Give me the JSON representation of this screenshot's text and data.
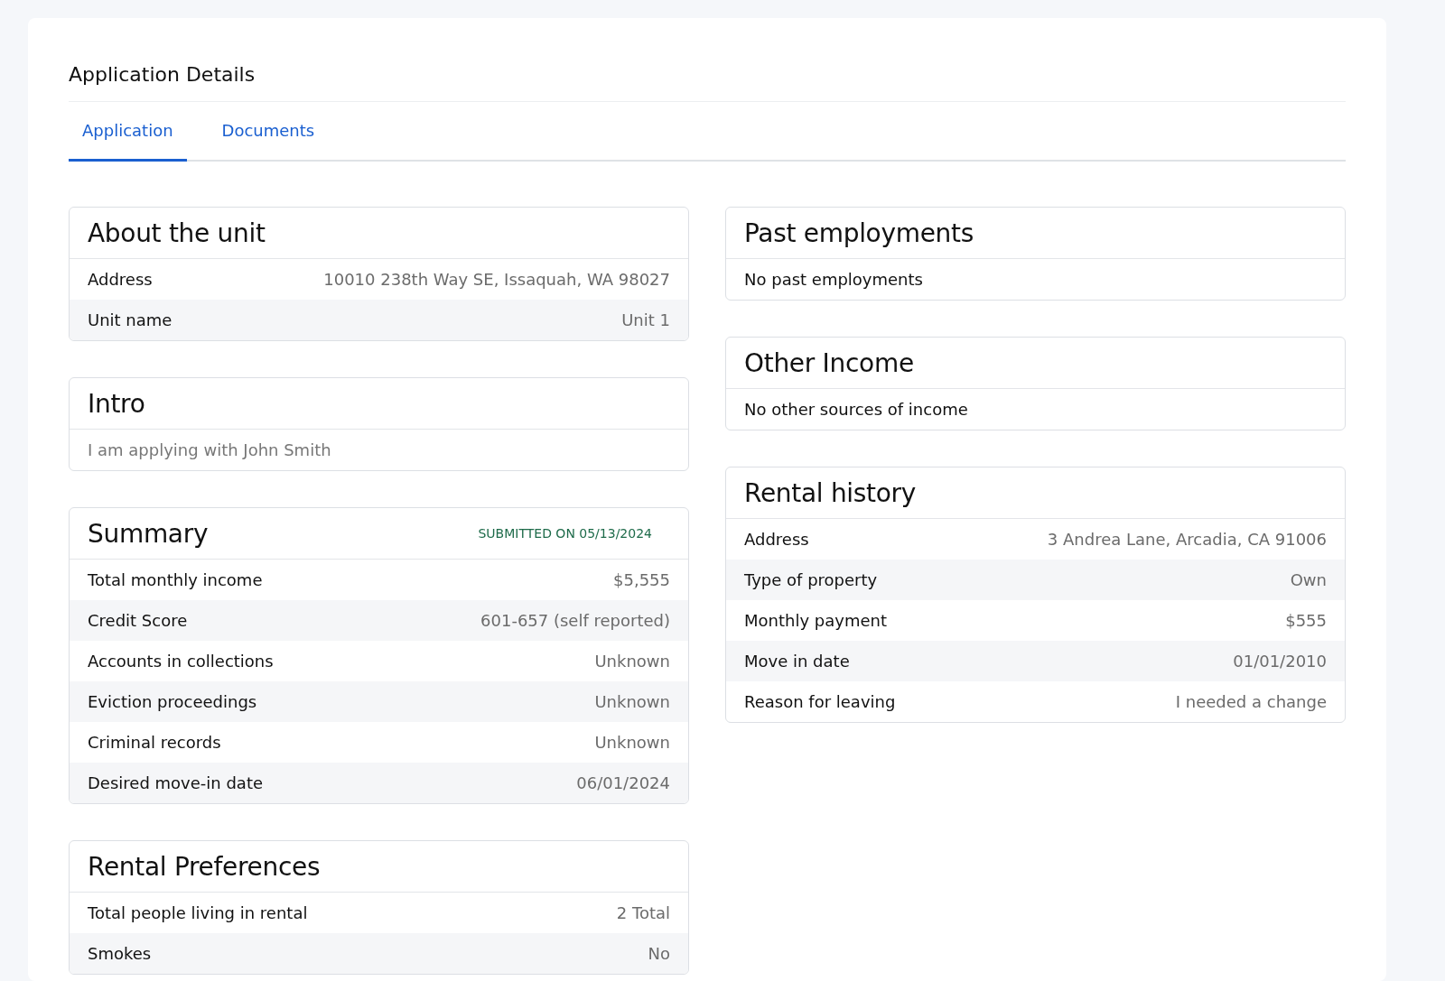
{
  "page": {
    "title": "Application Details"
  },
  "tabs": [
    {
      "label": "Application",
      "selected": true
    },
    {
      "label": "Documents",
      "selected": false
    }
  ],
  "left_column": [
    {
      "kind": "table",
      "title": "About the unit",
      "rows": [
        {
          "label": "Address",
          "value": "10010 238th Way SE, Issaquah, WA 98027"
        },
        {
          "label": "Unit name",
          "value": "Unit 1"
        }
      ]
    },
    {
      "kind": "text",
      "title": "Intro",
      "text": "I am applying with John Smith",
      "muted": true
    },
    {
      "kind": "table",
      "title": "Summary",
      "badge": "SUBMITTED ON 05/13/2024",
      "rows": [
        {
          "label": "Total monthly income",
          "value": "$5,555"
        },
        {
          "label": "Credit Score",
          "value": "601-657 (self reported)"
        },
        {
          "label": "Accounts in collections",
          "value": "Unknown"
        },
        {
          "label": "Eviction proceedings",
          "value": "Unknown"
        },
        {
          "label": "Criminal records",
          "value": "Unknown"
        },
        {
          "label": "Desired move-in date",
          "value": "06/01/2024"
        }
      ]
    },
    {
      "kind": "table",
      "title": "Rental Preferences",
      "rows": [
        {
          "label": "Total people living in rental",
          "value": "2 Total"
        },
        {
          "label": "Smokes",
          "value": "No"
        }
      ]
    }
  ],
  "right_column": [
    {
      "kind": "text",
      "title": "Past employments",
      "text": "No past employments",
      "muted": false
    },
    {
      "kind": "text",
      "title": "Other Income",
      "text": "No other sources of income",
      "muted": false
    },
    {
      "kind": "table",
      "title": "Rental history",
      "rows": [
        {
          "label": "Address",
          "value": "3 Andrea Lane, Arcadia, CA 91006"
        },
        {
          "label": "Type of property",
          "value": "Own"
        },
        {
          "label": "Monthly payment",
          "value": "$555"
        },
        {
          "label": "Move in date",
          "value": "01/01/2010"
        },
        {
          "label": "Reason for leaving",
          "value": "I needed a change"
        }
      ]
    }
  ]
}
